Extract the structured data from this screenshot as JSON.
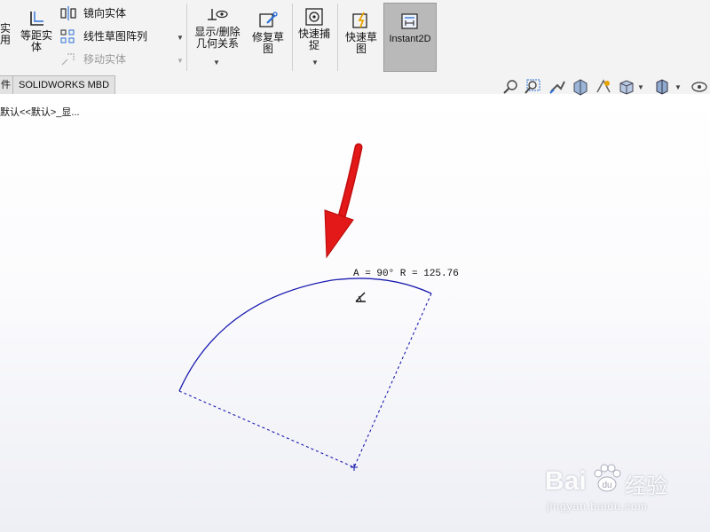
{
  "toolbar": {
    "convert_entities": {
      "label_line1": "实",
      "label_line2": "用"
    },
    "offset_entities": {
      "label_line1": "等距实",
      "label_line2": "体"
    },
    "mirror_entities": {
      "label": "镜向实体"
    },
    "linear_pattern": {
      "label": "线性草图阵列"
    },
    "move_entities": {
      "label": "移动实体"
    },
    "display_delete_relations": {
      "label_line1": "显示/删除",
      "label_line2": "几何关系"
    },
    "repair_sketch": {
      "label_line1": "修复草",
      "label_line2": "图"
    },
    "quick_snaps": {
      "label_line1": "快速捕",
      "label_line2": "捉"
    },
    "rapid_sketch": {
      "label_line1": "快速草",
      "label_line2": "图"
    },
    "instant2d": {
      "label": "Instant2D"
    }
  },
  "tabs": {
    "partial_tab": {
      "label": "件"
    },
    "mbd_tab": {
      "label": "SOLIDWORKS MBD"
    }
  },
  "tree_path": {
    "text": "默认<<默认>_显..."
  },
  "sketch": {
    "arc_readout": "A = 90°  R = 125.76",
    "line_color": "#1b1bb0"
  },
  "watermark": {
    "brand_left": "Bai",
    "brand_right": "经验",
    "url": "jingyan.baidu.com"
  },
  "colors": {
    "arrow": "#e11414",
    "instant2d_active": "#b9b9b9"
  }
}
